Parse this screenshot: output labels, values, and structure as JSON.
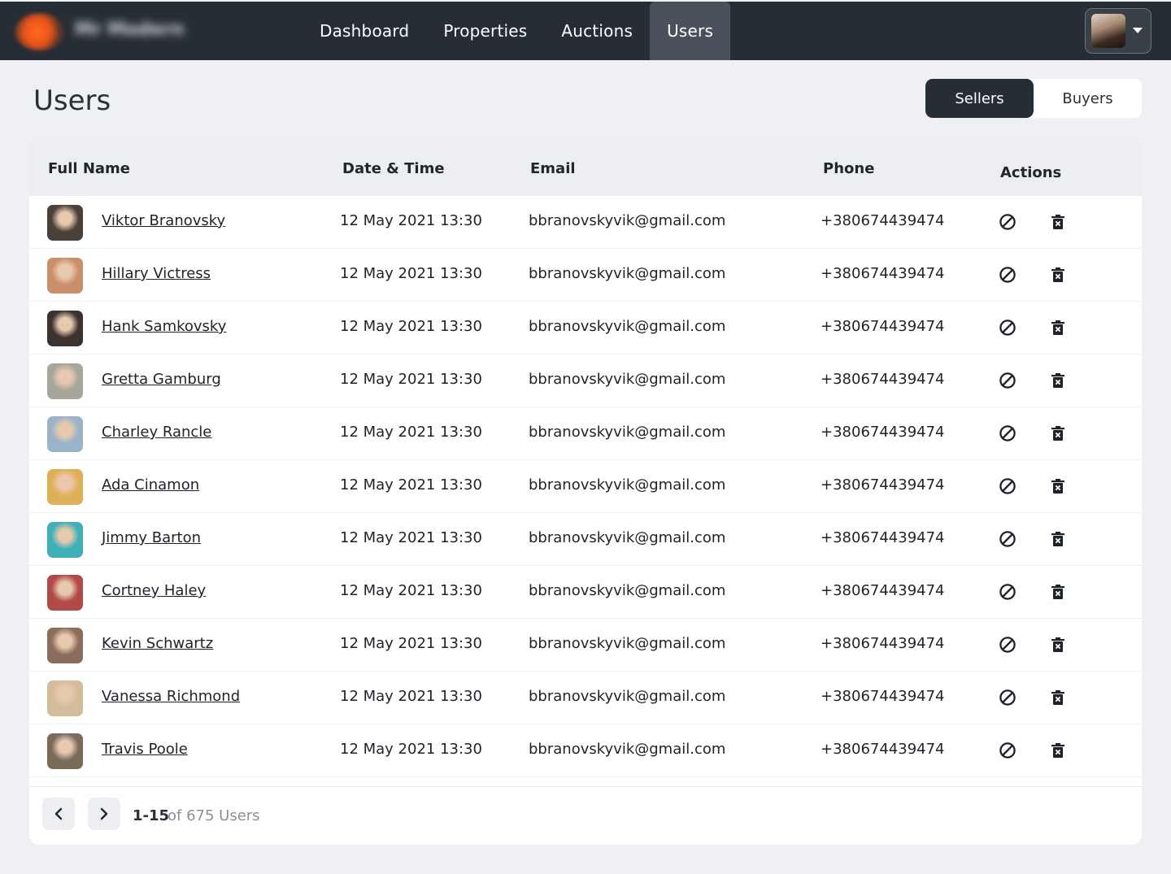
{
  "header": {
    "logo_text": "Mr Modern",
    "nav": [
      {
        "label": "Dashboard",
        "active": false
      },
      {
        "label": "Properties",
        "active": false
      },
      {
        "label": "Auctions",
        "active": false
      },
      {
        "label": "Users",
        "active": true
      }
    ]
  },
  "page": {
    "title": "Users",
    "toggle": {
      "sellers": "Sellers",
      "buyers": "Buyers",
      "selected": "Sellers"
    }
  },
  "table": {
    "columns": [
      "Full Name",
      "Date & Time",
      "Email",
      "Phone",
      "Actions"
    ],
    "rows": [
      {
        "name": "Viktor Branovsky",
        "datetime": "12 May 2021 13:30",
        "email": "bbranovskyvik@gmail.com",
        "phone": "+380674439474",
        "avatar_color": "#4a4038"
      },
      {
        "name": "Hillary Victress",
        "datetime": "12 May 2021 13:30",
        "email": "bbranovskyvik@gmail.com",
        "phone": "+380674439474",
        "avatar_color": "#c98f68"
      },
      {
        "name": "Hank Samkovsky",
        "datetime": "12 May 2021 13:30",
        "email": "bbranovskyvik@gmail.com",
        "phone": "+380674439474",
        "avatar_color": "#3c3330"
      },
      {
        "name": "Gretta Gamburg",
        "datetime": "12 May 2021 13:30",
        "email": "bbranovskyvik@gmail.com",
        "phone": "+380674439474",
        "avatar_color": "#a7a49c"
      },
      {
        "name": "Charley Rancle",
        "datetime": "12 May 2021 13:30",
        "email": "bbranovskyvik@gmail.com",
        "phone": "+380674439474",
        "avatar_color": "#9ab3c7"
      },
      {
        "name": "Ada Cinamon",
        "datetime": "12 May 2021 13:30",
        "email": "bbranovskyvik@gmail.com",
        "phone": "+380674439474",
        "avatar_color": "#e0b056"
      },
      {
        "name": "Jimmy Barton",
        "datetime": "12 May 2021 13:30",
        "email": "bbranovskyvik@gmail.com",
        "phone": "+380674439474",
        "avatar_color": "#3fb0b8"
      },
      {
        "name": "Cortney Haley",
        "datetime": "12 May 2021 13:30",
        "email": "bbranovskyvik@gmail.com",
        "phone": "+380674439474",
        "avatar_color": "#b04a46"
      },
      {
        "name": "Kevin Schwartz",
        "datetime": "12 May 2021 13:30",
        "email": "bbranovskyvik@gmail.com",
        "phone": "+380674439474",
        "avatar_color": "#8b6d5b"
      },
      {
        "name": "Vanessa Richmond",
        "datetime": "12 May 2021 13:30",
        "email": "bbranovskyvik@gmail.com",
        "phone": "+380674439474",
        "avatar_color": "#d3bc9a"
      },
      {
        "name": "Travis Poole",
        "datetime": "12 May 2021 13:30",
        "email": "bbranovskyvik@gmail.com",
        "phone": "+380674439474",
        "avatar_color": "#7a6a5c"
      }
    ],
    "action_icons": [
      "block-icon",
      "delete-icon"
    ]
  },
  "pagination": {
    "range": "1-15",
    "total": "of 675 Users"
  },
  "colors": {
    "topbar": "#272d35",
    "active_nav": "#4a515b",
    "page_bg": "#eef0f3",
    "header_row": "#eceef1"
  }
}
